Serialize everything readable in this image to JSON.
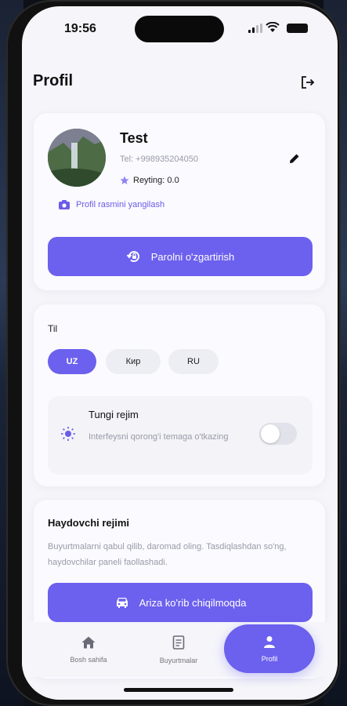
{
  "status": {
    "time": "19:56"
  },
  "header": {
    "title": "Profil"
  },
  "profile": {
    "name": "Test",
    "phone": "Tel: +998935204050",
    "rating": "Reyting: 0.0",
    "update_photo": "Profil rasmini yangilash",
    "change_password": "Parolni o'zgartirish"
  },
  "language": {
    "title": "Til",
    "options": [
      "UZ",
      "Кир",
      "RU"
    ],
    "selected": "UZ"
  },
  "night_mode": {
    "title": "Tungi rejim",
    "description": "Interfeysni qorong'i temaga o'tkazing",
    "enabled": false
  },
  "driver": {
    "title": "Haydovchi rejimi",
    "description": "Buyurtmalarni qabul qilib, daromad oling. Tasdiqlashdan so'ng, haydovchilar paneli faollashadi.",
    "button": "Ariza ko'rib chiqilmoqda"
  },
  "tabs": [
    {
      "label": "Bosh sahifa",
      "icon": "home-icon"
    },
    {
      "label": "Buyurtmalar",
      "icon": "orders-icon"
    },
    {
      "label": "Profil",
      "icon": "user-icon",
      "active": true
    }
  ],
  "colors": {
    "accent": "#6c60ee",
    "background": "#f5f5fa"
  }
}
